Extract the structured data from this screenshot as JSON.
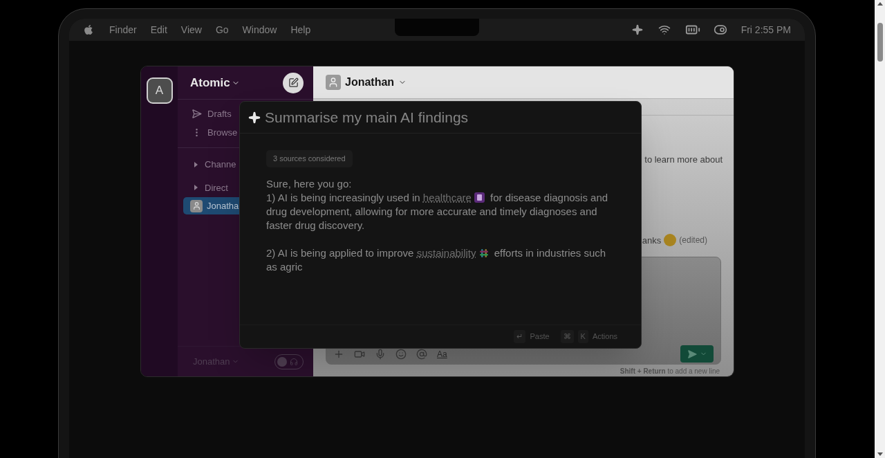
{
  "menubar": {
    "items": [
      "Finder",
      "Edit",
      "View",
      "Go",
      "Window",
      "Help"
    ],
    "clock": "Fri 2:55 PM"
  },
  "workspace": {
    "initial": "A",
    "name": "Atomic"
  },
  "sidebar": {
    "nav": [
      {
        "kind": "drafts",
        "label": "Drafts"
      },
      {
        "kind": "more",
        "label": "Browse"
      }
    ],
    "sections": [
      {
        "label": "Channe",
        "expanded": false
      },
      {
        "label": "Direct",
        "expanded": false
      }
    ],
    "direct_messages": [
      {
        "name": "Jonatha",
        "selected": true
      }
    ],
    "footer": {
      "name": "Jonathan",
      "huddle_on": false
    }
  },
  "conversation": {
    "title": "Jonathan",
    "fragments": [
      {
        "text": "to learn more about"
      },
      {
        "text": "anks",
        "edited": "(edited)"
      }
    ],
    "composer": {
      "format_label": "Aa",
      "hint": "**Shift + Return** to add a new line"
    }
  },
  "assistant": {
    "query": "Summarise my main AI findings",
    "sources": "3 sources considered",
    "intro": "Sure, here you go:",
    "paragraphs": [
      [
        {
          "kind": "text",
          "text": "1) AI is being increasingly used in "
        },
        {
          "kind": "link",
          "text": "healthcare"
        },
        {
          "kind": "notebook"
        },
        {
          "kind": "text",
          "text": " for disease diagnosis and drug development, allowing for more accurate and timely diagnoses and faster drug discovery."
        }
      ],
      [
        {
          "kind": "text",
          "text": "2) AI is being applied to improve "
        },
        {
          "kind": "link",
          "text": "sustainability"
        },
        {
          "kind": "chat"
        },
        {
          "kind": "text",
          "text": " efforts in industries such as agric"
        }
      ]
    ],
    "shortcuts": [
      {
        "keys": [
          "↵"
        ],
        "label": "Paste"
      },
      {
        "keys": [
          "⌘",
          "K"
        ],
        "label": "Actions"
      }
    ]
  }
}
